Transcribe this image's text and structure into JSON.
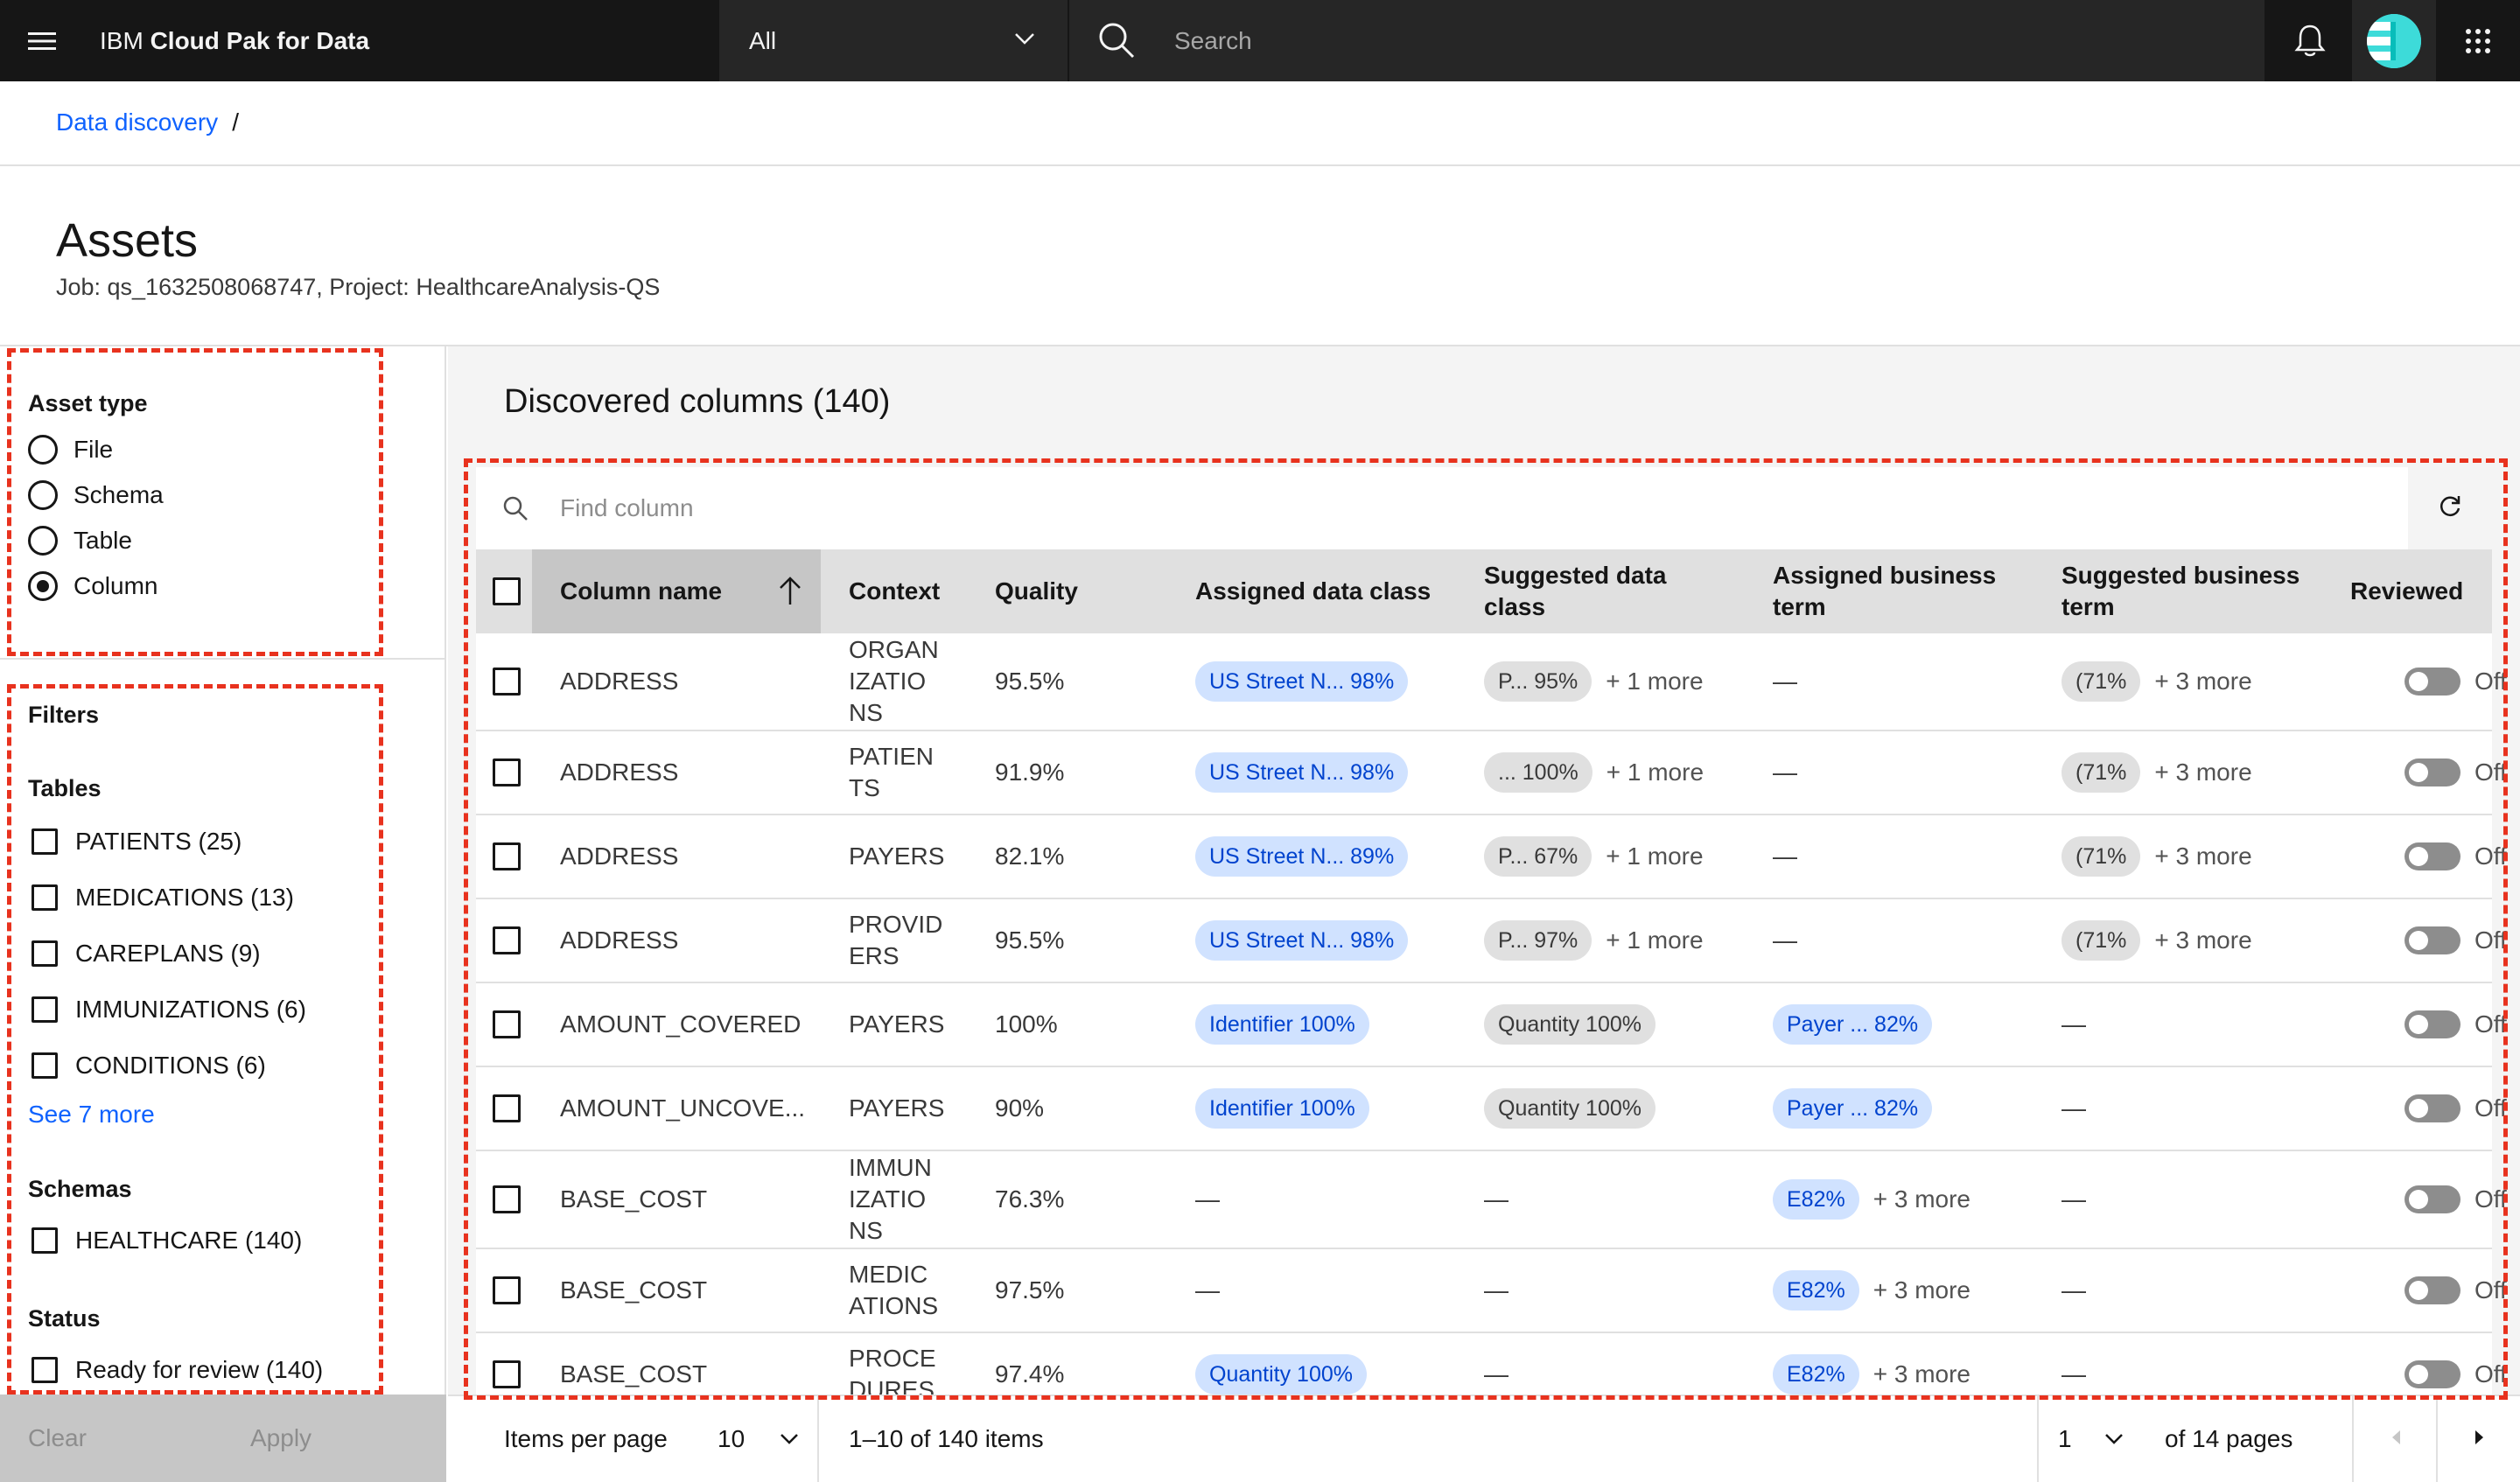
{
  "topbar": {
    "brand_prefix": "IBM",
    "brand_name": "Cloud Pak for Data",
    "scope_value": "All",
    "search_placeholder": "Search"
  },
  "breadcrumb": {
    "link": "Data discovery",
    "separator": "/"
  },
  "header": {
    "title": "Assets",
    "subtitle": "Job: qs_1632508068747, Project: HealthcareAnalysis-QS"
  },
  "asset_type": {
    "heading": "Asset type",
    "options": [
      "File",
      "Schema",
      "Table",
      "Column"
    ],
    "selected": "Column"
  },
  "filters": {
    "heading": "Filters",
    "tables_heading": "Tables",
    "tables": [
      "PATIENTS (25)",
      "MEDICATIONS (13)",
      "CAREPLANS (9)",
      "IMMUNIZATIONS (6)",
      "CONDITIONS (6)"
    ],
    "see_more": "See 7 more",
    "schemas_heading": "Schemas",
    "schemas": [
      "HEALTHCARE (140)"
    ],
    "status_heading": "Status",
    "status": [
      "Ready for review (140)"
    ],
    "clear_label": "Clear",
    "apply_label": "Apply"
  },
  "main": {
    "title": "Discovered columns (140)",
    "find_placeholder": "Find column"
  },
  "table": {
    "headers": {
      "column_name": "Column name",
      "context": "Context",
      "quality": "Quality",
      "assigned_class": "Assigned data class",
      "suggested_class_1": "Suggested data",
      "suggested_class_2": "class",
      "assigned_term_1": "Assigned business",
      "assigned_term_2": "term",
      "suggested_term_1": "Suggested business",
      "suggested_term_2": "term",
      "reviewed": "Reviewed"
    },
    "rows": [
      {
        "name": "ADDRESS",
        "context": [
          "ORGAN",
          "IZATIO",
          "NS"
        ],
        "quality": "95.5%",
        "assigned_class": "US Street N...  98%",
        "suggested_class": "P...  95%",
        "suggested_class_more": "+ 1 more",
        "assigned_term": "—",
        "assigned_term_more": "",
        "suggested_term": "(71%",
        "suggested_term_more": "+ 3 more",
        "reviewed": "Off"
      },
      {
        "name": "ADDRESS",
        "context": [
          "PATIEN",
          "TS"
        ],
        "quality": "91.9%",
        "assigned_class": "US Street N...  98%",
        "suggested_class": "...  100%",
        "suggested_class_more": "+ 1 more",
        "assigned_term": "—",
        "assigned_term_more": "",
        "suggested_term": "(71%",
        "suggested_term_more": "+ 3 more",
        "reviewed": "Off"
      },
      {
        "name": "ADDRESS",
        "context": [
          "PAYERS"
        ],
        "quality": "82.1%",
        "assigned_class": "US Street N...  89%",
        "suggested_class": "P...  67%",
        "suggested_class_more": "+ 1 more",
        "assigned_term": "—",
        "assigned_term_more": "",
        "suggested_term": "(71%",
        "suggested_term_more": "+ 3 more",
        "reviewed": "Off"
      },
      {
        "name": "ADDRESS",
        "context": [
          "PROVID",
          "ERS"
        ],
        "quality": "95.5%",
        "assigned_class": "US Street N...  98%",
        "suggested_class": "P...  97%",
        "suggested_class_more": "+ 1 more",
        "assigned_term": "—",
        "assigned_term_more": "",
        "suggested_term": "(71%",
        "suggested_term_more": "+ 3 more",
        "reviewed": "Off"
      },
      {
        "name": "AMOUNT_COVERED",
        "context": [
          "PAYERS"
        ],
        "quality": "100%",
        "assigned_class": "Identifier 100%",
        "suggested_class": "Quantity 100%",
        "suggested_class_more": "",
        "assigned_term": "Payer ...  82%",
        "assigned_term_more": "",
        "suggested_term": "—",
        "suggested_term_more": "",
        "reviewed": "Off"
      },
      {
        "name": "AMOUNT_UNCOVE...",
        "context": [
          "PAYERS"
        ],
        "quality": "90%",
        "assigned_class": "Identifier 100%",
        "suggested_class": "Quantity 100%",
        "suggested_class_more": "",
        "assigned_term": "Payer ...  82%",
        "assigned_term_more": "",
        "suggested_term": "—",
        "suggested_term_more": "",
        "reviewed": "Off"
      },
      {
        "name": "BASE_COST",
        "context": [
          "IMMUN",
          "IZATIO",
          "NS"
        ],
        "quality": "76.3%",
        "assigned_class": "—",
        "suggested_class": "—",
        "suggested_class_more": "",
        "assigned_term": "E82%",
        "assigned_term_more": "+ 3 more",
        "suggested_term": "—",
        "suggested_term_more": "",
        "reviewed": "Off"
      },
      {
        "name": "BASE_COST",
        "context": [
          "MEDIC",
          "ATIONS"
        ],
        "quality": "97.5%",
        "assigned_class": "—",
        "suggested_class": "—",
        "suggested_class_more": "",
        "assigned_term": "E82%",
        "assigned_term_more": "+ 3 more",
        "suggested_term": "—",
        "suggested_term_more": "",
        "reviewed": "Off"
      },
      {
        "name": "BASE_COST",
        "context": [
          "PROCE",
          "DURES"
        ],
        "quality": "97.4%",
        "assigned_class": "Quantity 100%",
        "suggested_class": "—",
        "suggested_class_more": "",
        "assigned_term": "E82%",
        "assigned_term_more": "+ 3 more",
        "suggested_term": "—",
        "suggested_term_more": "",
        "reviewed": "Off"
      }
    ]
  },
  "pagination": {
    "items_per_page_label": "Items per page",
    "items_per_page": "10",
    "range": "1–10 of 140 items",
    "page": "1",
    "of_pages": "of 14 pages"
  },
  "colors": {
    "accent": "#0f62fe",
    "highlight": "#e8321e",
    "topbar": "#161616"
  }
}
